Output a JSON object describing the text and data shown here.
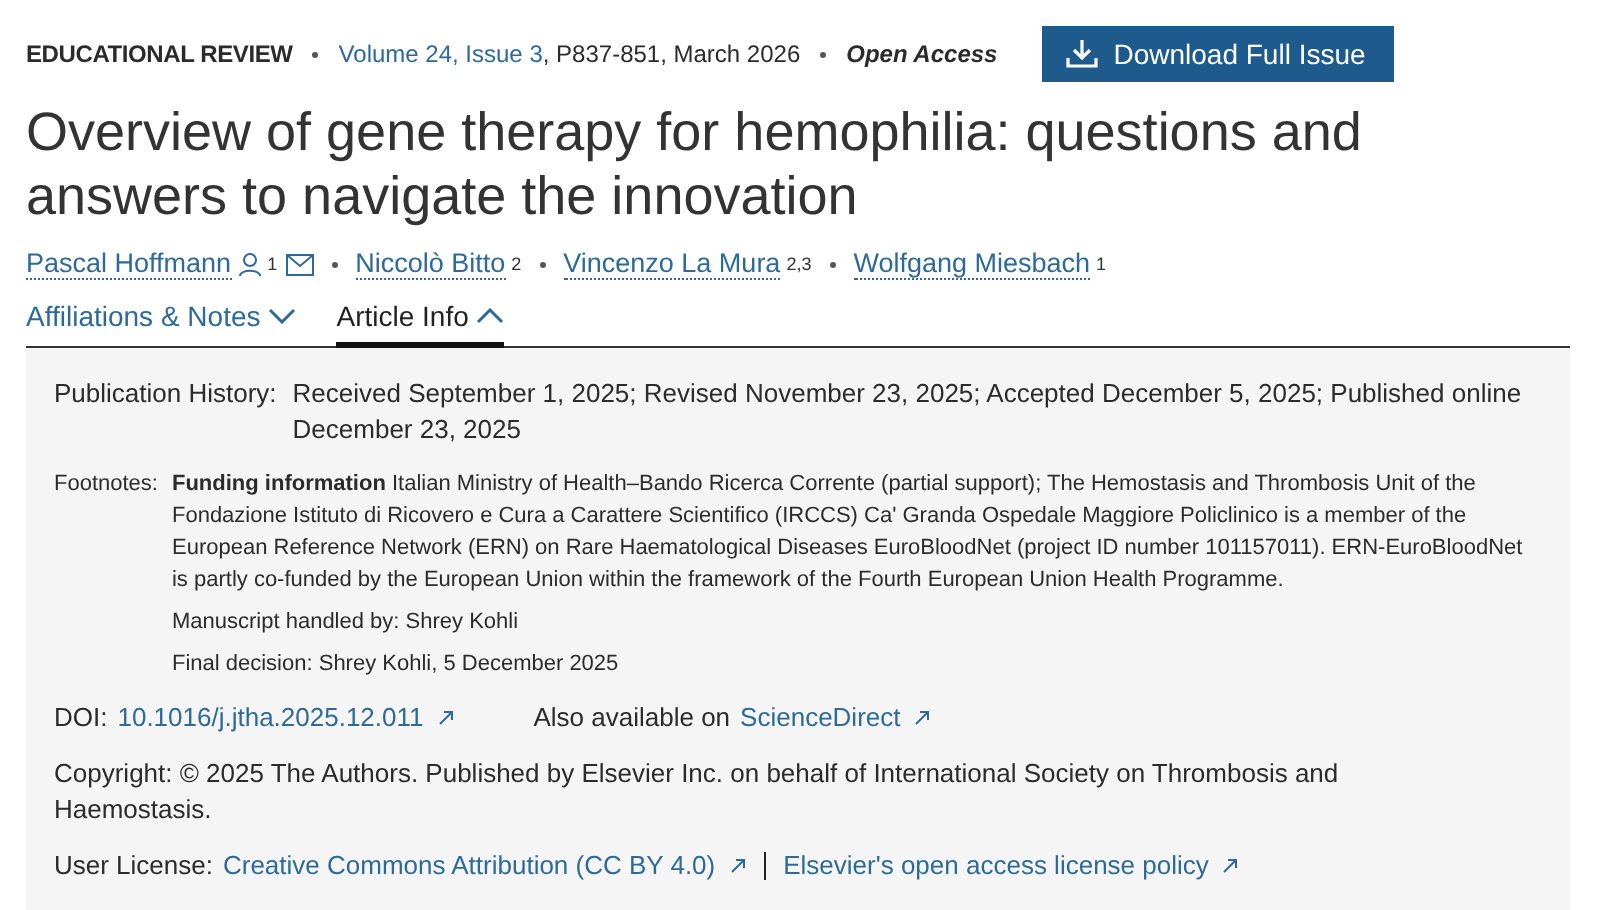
{
  "journal": {
    "name": "EDUCATIONAL REVIEW",
    "issue_link": "Volume 24, Issue 3",
    "pages_date": ", P837-851, March 2026",
    "access": "Open Access"
  },
  "download_button": {
    "label": "Download Full Issue"
  },
  "title": "Overview of gene therapy for hemophilia: questions and answers to navigate the innovation",
  "authors": [
    {
      "name": "Pascal Hoffmann",
      "affiliation": "1",
      "corresponding": true
    },
    {
      "name": "Niccolò Bitto",
      "affiliation": "2",
      "corresponding": false
    },
    {
      "name": "Vincenzo La Mura",
      "affiliation": "2,3",
      "corresponding": false
    },
    {
      "name": "Wolfgang Miesbach",
      "affiliation": "1",
      "corresponding": false
    }
  ],
  "tabs": [
    {
      "label": "Affiliations & Notes",
      "selected": false
    },
    {
      "label": "Article Info",
      "selected": true
    }
  ],
  "info": {
    "publication_history": {
      "label": "Publication History:",
      "value": "Received September 1, 2025; Revised November 23, 2025; Accepted December 5, 2025; Published online December 23, 2025"
    },
    "footnotes": {
      "label": "Footnotes:",
      "text": "**Funding information** Italian Ministry of Health–Bando Ricerca Corrente (partial support); The Hemostasis and Thrombosis Unit of the Fondazione Istituto di Ricovero e Cura a Carattere Scientifico (IRCCS) Ca' Granda Ospedale Maggiore Policlinico is a member of the European Reference Network (ERN) on Rare Haematological Diseases EuroBloodNet (project ID number 101157011). ERN-EuroBloodNet is partly co-funded by the European Union within the framework of the Fourth European Union Health Programme.",
      "handled_by": "Manuscript handled by: Shrey Kohli",
      "final_decision": "Final decision: Shrey Kohli, 5 December 2025"
    },
    "doi": {
      "label": "DOI:",
      "link": "10.1016/j.jtha.2025.12.011"
    },
    "also_available": {
      "text": "Also available on",
      "link": "ScienceDirect"
    },
    "copyright": "Copyright: © 2025 The Authors. Published by Elsevier Inc. on behalf of International Society on Thrombosis and Haemostasis.",
    "license": {
      "label": "User License:",
      "links": [
        "Creative Commons Attribution (CC BY 4.0)",
        "Elsevier's open access license policy"
      ]
    }
  }
}
